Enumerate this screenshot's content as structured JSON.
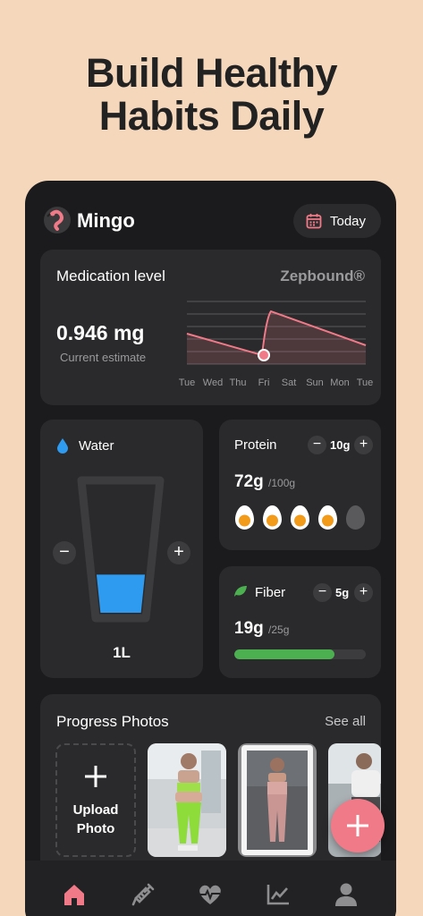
{
  "headline": {
    "line1": "Build Healthy",
    "line2": "Habits Daily"
  },
  "app": {
    "name": "Mingo",
    "today_label": "Today",
    "accent": "#f07a87"
  },
  "medication": {
    "title": "Medication level",
    "brand": "Zepbound®",
    "value": "0.946 mg",
    "subtitle": "Current estimate",
    "days": [
      "Tue",
      "Wed",
      "Thu",
      "Fri",
      "Sat",
      "Sun",
      "Mon",
      "Tue"
    ]
  },
  "water": {
    "title": "Water",
    "amount": "1L",
    "fill_fraction": 0.3,
    "color": "#2f9bf0"
  },
  "protein": {
    "title": "Protein",
    "step": "10g",
    "value": "72g",
    "goal": "/100g",
    "eggs_filled": 4,
    "eggs_total": 5
  },
  "fiber": {
    "title": "Fiber",
    "step": "5g",
    "value": "19g",
    "goal": "/25g",
    "progress": 0.76,
    "color": "#4caf50"
  },
  "photos": {
    "title": "Progress Photos",
    "see_all": "See all",
    "upload_line1": "Upload",
    "upload_line2": "Photo"
  },
  "tabs": [
    "home-icon",
    "syringe-icon",
    "heart-pulse-icon",
    "chart-icon",
    "profile-icon"
  ]
}
